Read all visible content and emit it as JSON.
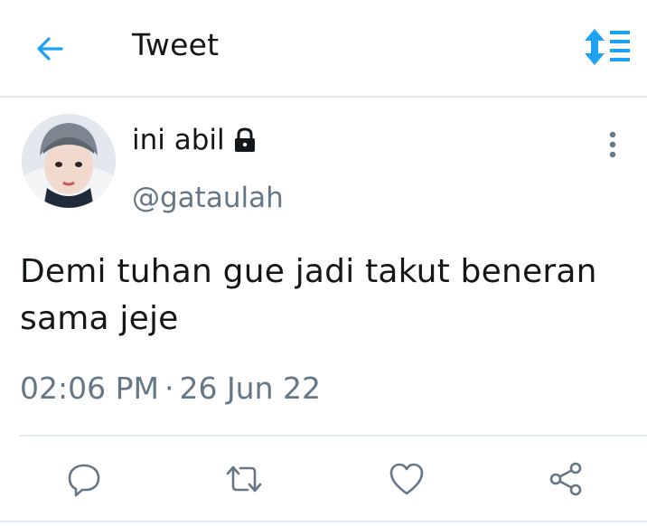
{
  "header": {
    "title": "Tweet",
    "back_icon": "arrow-left-icon",
    "sort_icon": "sort-icon",
    "accent_color": "#1da1f2"
  },
  "author": {
    "display_name": "ini abil",
    "handle": "@gataulah",
    "protected_icon": "lock-icon"
  },
  "tweet": {
    "text": "Demi tuhan gue jadi takut beneran sama jeje",
    "time": "02:06 PM",
    "separator": "·",
    "date": "26 Jun 22"
  },
  "actions": {
    "items": [
      "reply-icon",
      "retweet-icon",
      "like-icon",
      "share-icon"
    ],
    "icon_color": "#657786"
  }
}
